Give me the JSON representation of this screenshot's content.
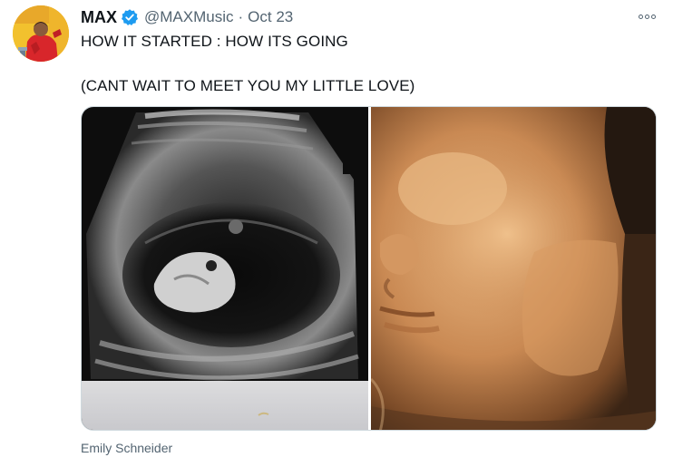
{
  "tweet": {
    "author_name": "MAX",
    "author_handle": "@MAXMusic",
    "separator": "·",
    "date": "Oct 23",
    "text_line1": "HOW IT STARTED : HOW ITS GOING",
    "text_line2": "(CANT WAIT TO MEET YOU MY LITTLE LOVE)",
    "more_icon": "more-horizontal-icon",
    "verified_icon": "verified-badge-icon",
    "credit": "Emily Schneider"
  },
  "media": {
    "left_image": "ultrasound-scan-image",
    "right_image": "3d-ultrasound-face-image"
  },
  "colors": {
    "text_primary": "#0f1419",
    "text_secondary": "#536471",
    "verified_blue": "#1d9bf0",
    "border": "#cfd9de"
  }
}
